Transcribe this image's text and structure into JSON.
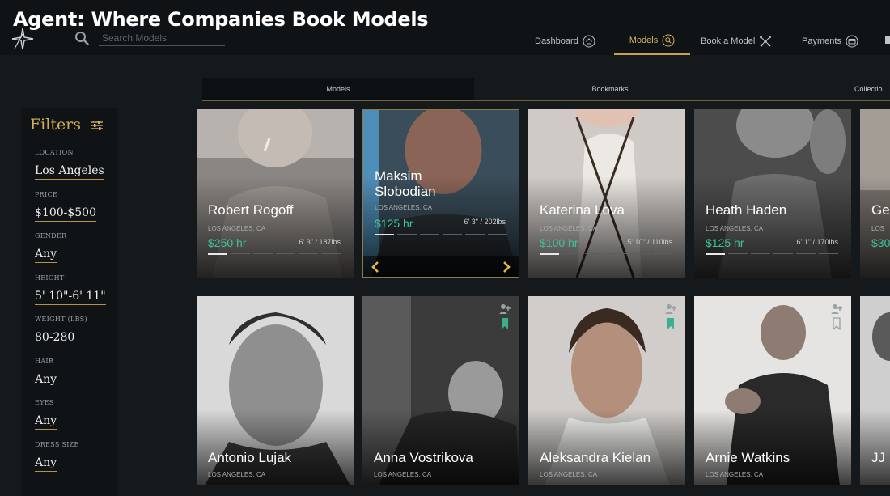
{
  "headline": "Agent: Where Companies Book Models",
  "search": {
    "placeholder": "Search Models",
    "icon": "search-icon"
  },
  "nav": {
    "dashboard": "Dashboard",
    "models": "Models",
    "book": "Book a Model",
    "payments": "Payments"
  },
  "tabs": [
    "Models",
    "Bookmarks",
    "Collectio"
  ],
  "filters": {
    "title": "Filters",
    "items": [
      {
        "label": "LOCATION",
        "value": "Los Angeles"
      },
      {
        "label": "PRICE",
        "value": "$100-$500"
      },
      {
        "label": "GENDER",
        "value": "Any"
      },
      {
        "label": "HEIGHT",
        "value": "5' 10\"-6' 11\""
      },
      {
        "label": "WEIGHT (LBS)",
        "value": "80-280"
      },
      {
        "label": "HAIR",
        "value": "Any"
      },
      {
        "label": "EYES",
        "value": "Any"
      },
      {
        "label": "DRESS SIZE",
        "value": "Any"
      }
    ]
  },
  "models_row1": [
    {
      "name": "Robert Rogoff",
      "location": "LOS ANGELES, CA",
      "price": "$250 hr",
      "stats": "6' 3\" / 187lbs"
    },
    {
      "name": "Maksim Slobodian",
      "location": "LOS ANGELES, CA",
      "price": "$125 hr",
      "stats": "6' 3\" / 202lbs"
    },
    {
      "name": "Katerina Lova",
      "location": "LOS ANGELES, CA",
      "price": "$100 hr",
      "stats": "5' 10\" / 110lbs"
    },
    {
      "name": "Heath Haden",
      "location": "LOS ANGELES, CA",
      "price": "$125 hr",
      "stats": "6' 1\" / 170lbs"
    },
    {
      "name": "Ge",
      "location": "LOS",
      "price": "$30",
      "stats": ""
    }
  ],
  "models_row2": [
    {
      "name": "Antonio Lujak",
      "location": "LOS ANGELES, CA"
    },
    {
      "name": "Anna Vostrikova",
      "location": "LOS ANGELES, CA"
    },
    {
      "name": "Aleksandra Kielan",
      "location": "LOS ANGELES, CA"
    },
    {
      "name": "Arnie Watkins",
      "location": "LOS ANGELES, CA"
    },
    {
      "name": "JJ",
      "location": ""
    }
  ],
  "colors": {
    "accent": "#c9a14f",
    "price": "#3bc49b",
    "bookmark": "#3bb08f",
    "background": "#15191c"
  }
}
